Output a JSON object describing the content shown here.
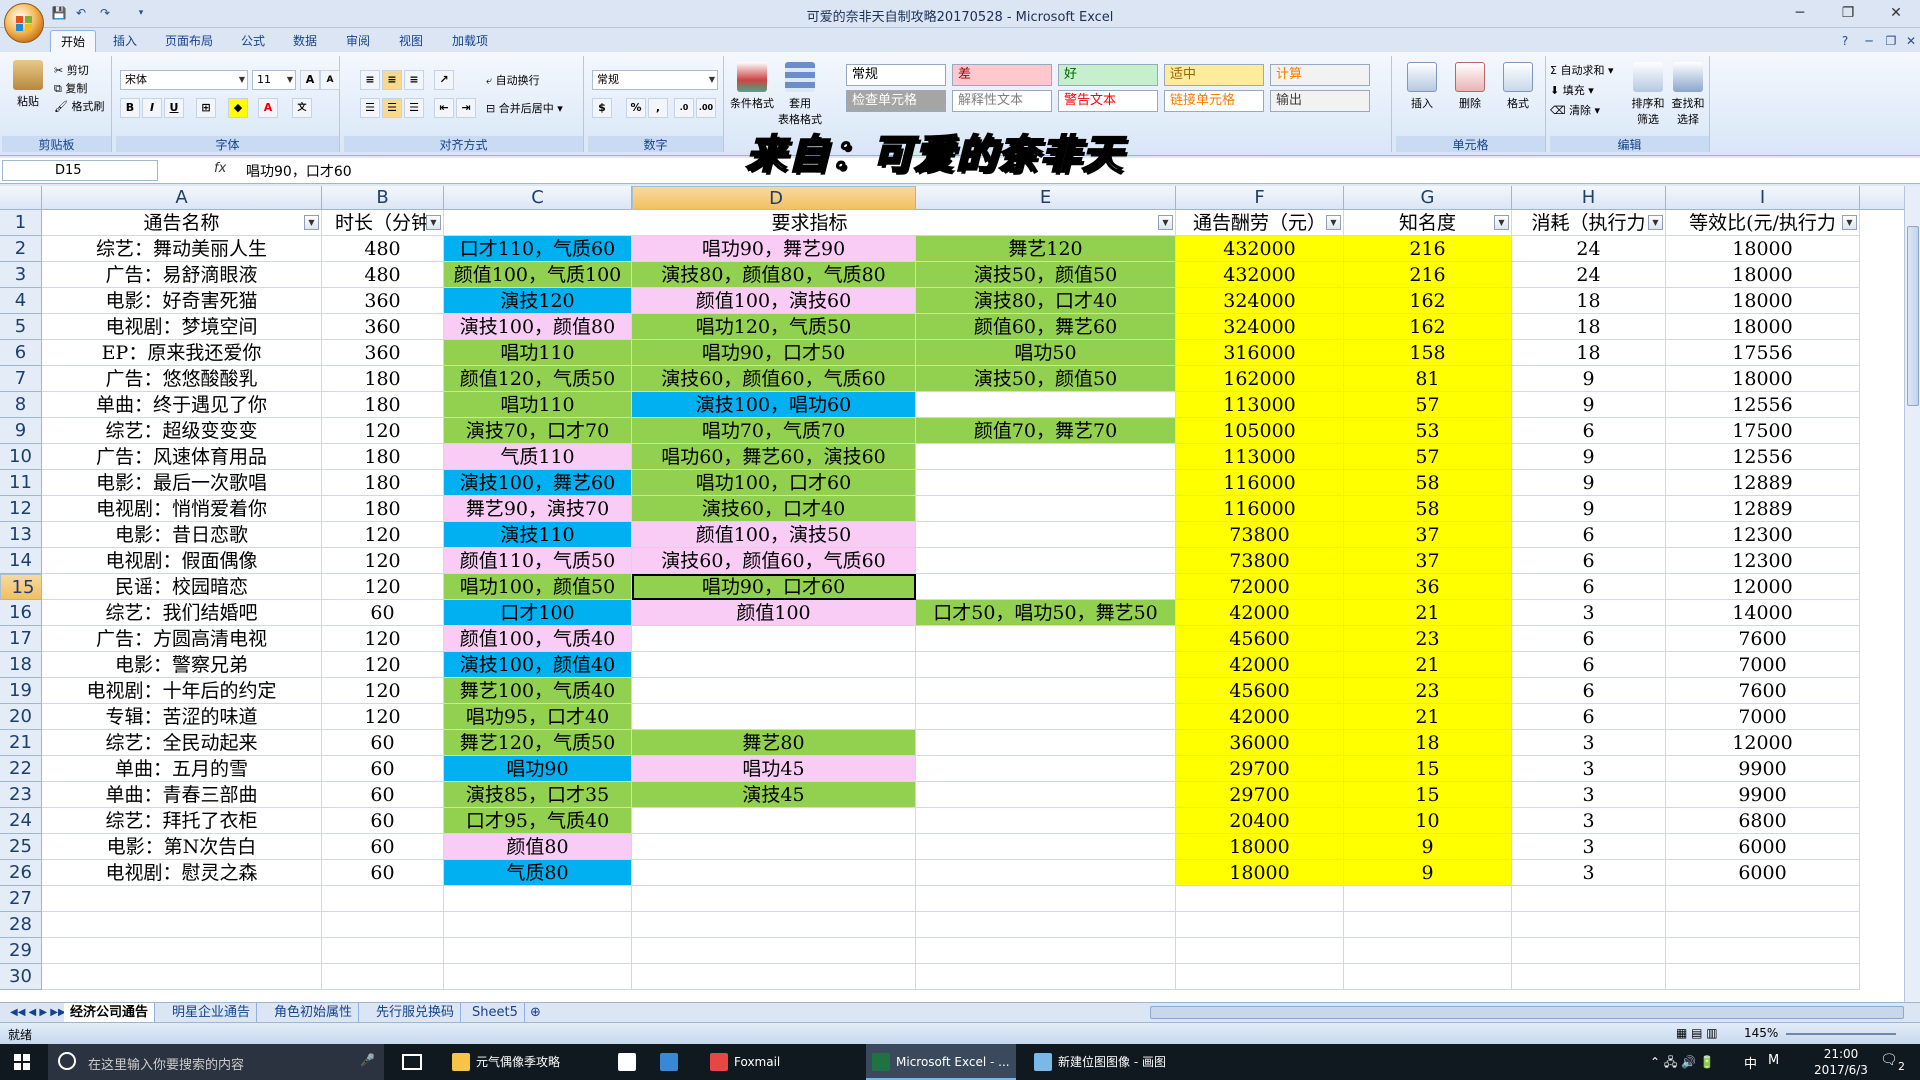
{
  "window": {
    "title": "可爱的奈非天自制攻略20170528 - Microsoft Excel"
  },
  "ribbon_tabs": [
    "开始",
    "插入",
    "页面布局",
    "公式",
    "数据",
    "审阅",
    "视图",
    "加载项"
  ],
  "ribbon": {
    "clipboard": {
      "paste": "粘贴",
      "cut": "剪切",
      "copy": "复制",
      "format_painter": "格式刷",
      "label": "剪贴板"
    },
    "font": {
      "name": "宋体",
      "size": "11",
      "label": "字体"
    },
    "alignment": {
      "wrap": "自动换行",
      "merge": "合并后居中",
      "label": "对齐方式"
    },
    "number": {
      "format": "常规",
      "label": "数字"
    },
    "styles": {
      "conditional": "条件格式",
      "table_format": "套用\n表格格式",
      "cells": [
        {
          "text": "常规",
          "bg": "#ffffff",
          "color": "#000000"
        },
        {
          "text": "差",
          "bg": "#ffc7ce",
          "color": "#9c0006"
        },
        {
          "text": "好",
          "bg": "#c6efce",
          "color": "#006100"
        },
        {
          "text": "适中",
          "bg": "#ffeb9c",
          "color": "#9c6500"
        },
        {
          "text": "计算",
          "bg": "#f2f2f2",
          "color": "#fa7d00"
        },
        {
          "text": "检查单元格",
          "bg": "#a5a5a5",
          "color": "#ffffff"
        },
        {
          "text": "解释性文本",
          "bg": "#ffffff",
          "color": "#7f7f7f"
        },
        {
          "text": "警告文本",
          "bg": "#ffffff",
          "color": "#ff0000"
        },
        {
          "text": "链接单元格",
          "bg": "#ffffff",
          "color": "#fa7d00"
        },
        {
          "text": "输出",
          "bg": "#f2f2f2",
          "color": "#3f3f3f"
        }
      ]
    },
    "cells_group": {
      "insert": "插入",
      "delete": "删除",
      "format": "格式",
      "label": "单元格"
    },
    "editing": {
      "autosum": "自动求和",
      "fill": "填充",
      "clear": "清除",
      "sort": "排序和\n筛选",
      "find": "查找和\n选择",
      "label": "编辑"
    }
  },
  "watermark": "来自：可爱的奈非天",
  "formula_bar": {
    "name_box": "D15",
    "fx": "fx",
    "formula": "唱功90，口才60"
  },
  "columns": [
    "A",
    "B",
    "C",
    "D",
    "E",
    "F",
    "G",
    "H",
    "I"
  ],
  "selected_column": "D",
  "selected_row": 15,
  "header_row": [
    "通告名称",
    "时长（分钟",
    "要求指标",
    "",
    "",
    "通告酬劳（元）",
    "知名度",
    "消耗（执行力",
    "等效比(元/执行力"
  ],
  "colors": {
    "pink": "#f9ccf5",
    "green": "#92d050",
    "blue": "#00b0f0",
    "yellow": "#ffff00"
  },
  "rows": [
    {
      "a": "综艺：舞动美丽人生",
      "b": "480",
      "c": "口才110，气质60",
      "cc": "blue",
      "d": "唱功90，舞艺90",
      "dc": "pink",
      "e": "舞艺120",
      "ec": "green",
      "f": "432000",
      "g": "216",
      "h": "24",
      "i": "18000"
    },
    {
      "a": "广告：易舒滴眼液",
      "b": "480",
      "c": "颜值100，气质100",
      "cc": "green",
      "d": "演技80，颜值80，气质80",
      "dc": "green",
      "e": "演技50，颜值50",
      "ec": "green",
      "f": "432000",
      "g": "216",
      "h": "24",
      "i": "18000"
    },
    {
      "a": "电影：好奇害死猫",
      "b": "360",
      "c": "演技120",
      "cc": "blue",
      "d": "颜值100，演技60",
      "dc": "pink",
      "e": "演技80，口才40",
      "ec": "green",
      "f": "324000",
      "g": "162",
      "h": "18",
      "i": "18000"
    },
    {
      "a": "电视剧：梦境空间",
      "b": "360",
      "c": "演技100，颜值80",
      "cc": "pink",
      "d": "唱功120，气质50",
      "dc": "green",
      "e": "颜值60，舞艺60",
      "ec": "green",
      "f": "324000",
      "g": "162",
      "h": "18",
      "i": "18000"
    },
    {
      "a": "EP：原来我还爱你",
      "b": "360",
      "c": "唱功110",
      "cc": "green",
      "d": "唱功90，口才50",
      "dc": "green",
      "e": "唱功50",
      "ec": "green",
      "f": "316000",
      "g": "158",
      "h": "18",
      "i": "17556"
    },
    {
      "a": "广告：悠悠酸酸乳",
      "b": "180",
      "c": "颜值120，气质50",
      "cc": "green",
      "d": "演技60，颜值60，气质60",
      "dc": "green",
      "e": "演技50，颜值50",
      "ec": "green",
      "f": "162000",
      "g": "81",
      "h": "9",
      "i": "18000"
    },
    {
      "a": "单曲：终于遇见了你",
      "b": "180",
      "c": "唱功110",
      "cc": "green",
      "d": "演技100，唱功60",
      "dc": "blue",
      "e": "",
      "ec": "",
      "f": "113000",
      "g": "57",
      "h": "9",
      "i": "12556"
    },
    {
      "a": "综艺：超级变变变",
      "b": "120",
      "c": "演技70，口才70",
      "cc": "green",
      "d": "唱功70，气质70",
      "dc": "green",
      "e": "颜值70，舞艺70",
      "ec": "green",
      "f": "105000",
      "g": "53",
      "h": "6",
      "i": "17500"
    },
    {
      "a": "广告：风速体育用品",
      "b": "180",
      "c": "气质110",
      "cc": "pink",
      "d": "唱功60，舞艺60，演技60",
      "dc": "green",
      "e": "",
      "ec": "",
      "f": "113000",
      "g": "57",
      "h": "9",
      "i": "12556"
    },
    {
      "a": "电影：最后一次歌唱",
      "b": "180",
      "c": "演技100，舞艺60",
      "cc": "blue",
      "d": "唱功100，口才60",
      "dc": "green",
      "e": "",
      "ec": "",
      "f": "116000",
      "g": "58",
      "h": "9",
      "i": "12889"
    },
    {
      "a": "电视剧：悄悄爱着你",
      "b": "180",
      "c": "舞艺90，演技70",
      "cc": "pink",
      "d": "演技60，口才40",
      "dc": "green",
      "e": "",
      "ec": "",
      "f": "116000",
      "g": "58",
      "h": "9",
      "i": "12889"
    },
    {
      "a": "电影：昔日恋歌",
      "b": "120",
      "c": "演技110",
      "cc": "blue",
      "d": "颜值100，演技50",
      "dc": "pink",
      "e": "",
      "ec": "",
      "f": "73800",
      "g": "37",
      "h": "6",
      "i": "12300"
    },
    {
      "a": "电视剧：假面偶像",
      "b": "120",
      "c": "颜值110，气质50",
      "cc": "pink",
      "d": "演技60，颜值60，气质60",
      "dc": "pink",
      "e": "",
      "ec": "",
      "f": "73800",
      "g": "37",
      "h": "6",
      "i": "12300"
    },
    {
      "a": "民谣：校园暗恋",
      "b": "120",
      "c": "唱功100，颜值50",
      "cc": "green",
      "d": "唱功90，口才60",
      "dc": "green",
      "e": "",
      "ec": "",
      "f": "72000",
      "g": "36",
      "h": "6",
      "i": "12000"
    },
    {
      "a": "综艺：我们结婚吧",
      "b": "60",
      "c": "口才100",
      "cc": "blue",
      "d": "颜值100",
      "dc": "pink",
      "e": "口才50，唱功50，舞艺50",
      "ec": "green",
      "f": "42000",
      "g": "21",
      "h": "3",
      "i": "14000"
    },
    {
      "a": "广告：方圆高清电视",
      "b": "120",
      "c": "颜值100，气质40",
      "cc": "pink",
      "d": "",
      "dc": "",
      "e": "",
      "ec": "",
      "f": "45600",
      "g": "23",
      "h": "6",
      "i": "7600"
    },
    {
      "a": "电影：警察兄弟",
      "b": "120",
      "c": "演技100，颜值40",
      "cc": "blue",
      "d": "",
      "dc": "",
      "e": "",
      "ec": "",
      "f": "42000",
      "g": "21",
      "h": "6",
      "i": "7000"
    },
    {
      "a": "电视剧：十年后的约定",
      "b": "120",
      "c": "舞艺100，气质40",
      "cc": "green",
      "d": "",
      "dc": "",
      "e": "",
      "ec": "",
      "f": "45600",
      "g": "23",
      "h": "6",
      "i": "7600"
    },
    {
      "a": "专辑：苦涩的味道",
      "b": "120",
      "c": "唱功95，口才40",
      "cc": "green",
      "d": "",
      "dc": "",
      "e": "",
      "ec": "",
      "f": "42000",
      "g": "21",
      "h": "6",
      "i": "7000"
    },
    {
      "a": "综艺：全民动起来",
      "b": "60",
      "c": "舞艺120，气质50",
      "cc": "green",
      "d": "舞艺80",
      "dc": "green",
      "e": "",
      "ec": "",
      "f": "36000",
      "g": "18",
      "h": "3",
      "i": "12000"
    },
    {
      "a": "单曲：五月的雪",
      "b": "60",
      "c": "唱功90",
      "cc": "blue",
      "d": "唱功45",
      "dc": "pink",
      "e": "",
      "ec": "",
      "f": "29700",
      "g": "15",
      "h": "3",
      "i": "9900"
    },
    {
      "a": "单曲：青春三部曲",
      "b": "60",
      "c": "演技85，口才35",
      "cc": "green",
      "d": "演技45",
      "dc": "green",
      "e": "",
      "ec": "",
      "f": "29700",
      "g": "15",
      "h": "3",
      "i": "9900"
    },
    {
      "a": "综艺：拜托了衣柜",
      "b": "60",
      "c": "口才95，气质40",
      "cc": "green",
      "d": "",
      "dc": "",
      "e": "",
      "ec": "",
      "f": "20400",
      "g": "10",
      "h": "3",
      "i": "6800"
    },
    {
      "a": "电影：第N次告白",
      "b": "60",
      "c": "颜值80",
      "cc": "pink",
      "d": "",
      "dc": "",
      "e": "",
      "ec": "",
      "f": "18000",
      "g": "9",
      "h": "3",
      "i": "6000"
    },
    {
      "a": "电视剧：慰灵之森",
      "b": "60",
      "c": "气质80",
      "cc": "blue",
      "d": "",
      "dc": "",
      "e": "",
      "ec": "",
      "f": "18000",
      "g": "9",
      "h": "3",
      "i": "6000"
    }
  ],
  "empty_rows": [
    "27",
    "28",
    "29",
    "30"
  ],
  "sheet_tabs": [
    "经济公司通告",
    "明星企业通告",
    "角色初始属性",
    "先行服兑换码",
    "Sheet5"
  ],
  "status": {
    "ready": "就绪",
    "zoom": "145%"
  },
  "taskbar": {
    "search_placeholder": "在这里输入你要搜索的内容",
    "items": [
      "元气偶像季攻略",
      "Foxmail",
      "Microsoft Excel - ...",
      "新建位图图像 - 画图"
    ],
    "ime": "中",
    "ime2": "M",
    "time": "21:00",
    "date": "2017/6/3",
    "notif": "2"
  }
}
